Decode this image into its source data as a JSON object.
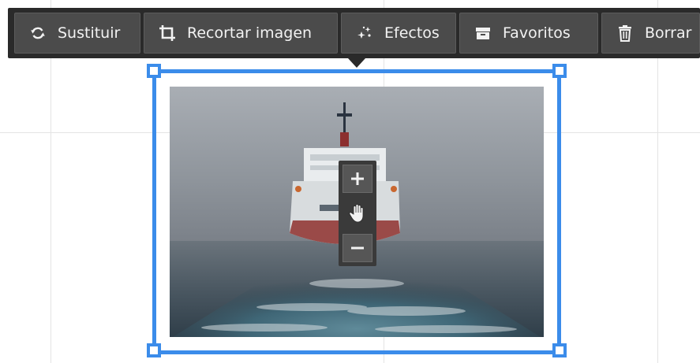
{
  "toolbar": {
    "buttons": [
      {
        "label": "Sustituir",
        "icon": "refresh-icon"
      },
      {
        "label": "Recortar imagen",
        "icon": "crop-icon"
      },
      {
        "label": "Efectos",
        "icon": "sparkle-icon"
      },
      {
        "label": "Favoritos",
        "icon": "archive-box-icon"
      },
      {
        "label": "Borrar",
        "icon": "trash-icon"
      }
    ]
  },
  "image": {
    "subject": "cargo ship stern view on grey sea",
    "zoom_controls": [
      "zoom-in-icon",
      "hand-pan-icon",
      "zoom-out-icon"
    ]
  },
  "colors": {
    "toolbar_bg": "#2a2a2a",
    "button_bg": "#4b4b4b",
    "selection": "#3b8cea"
  }
}
